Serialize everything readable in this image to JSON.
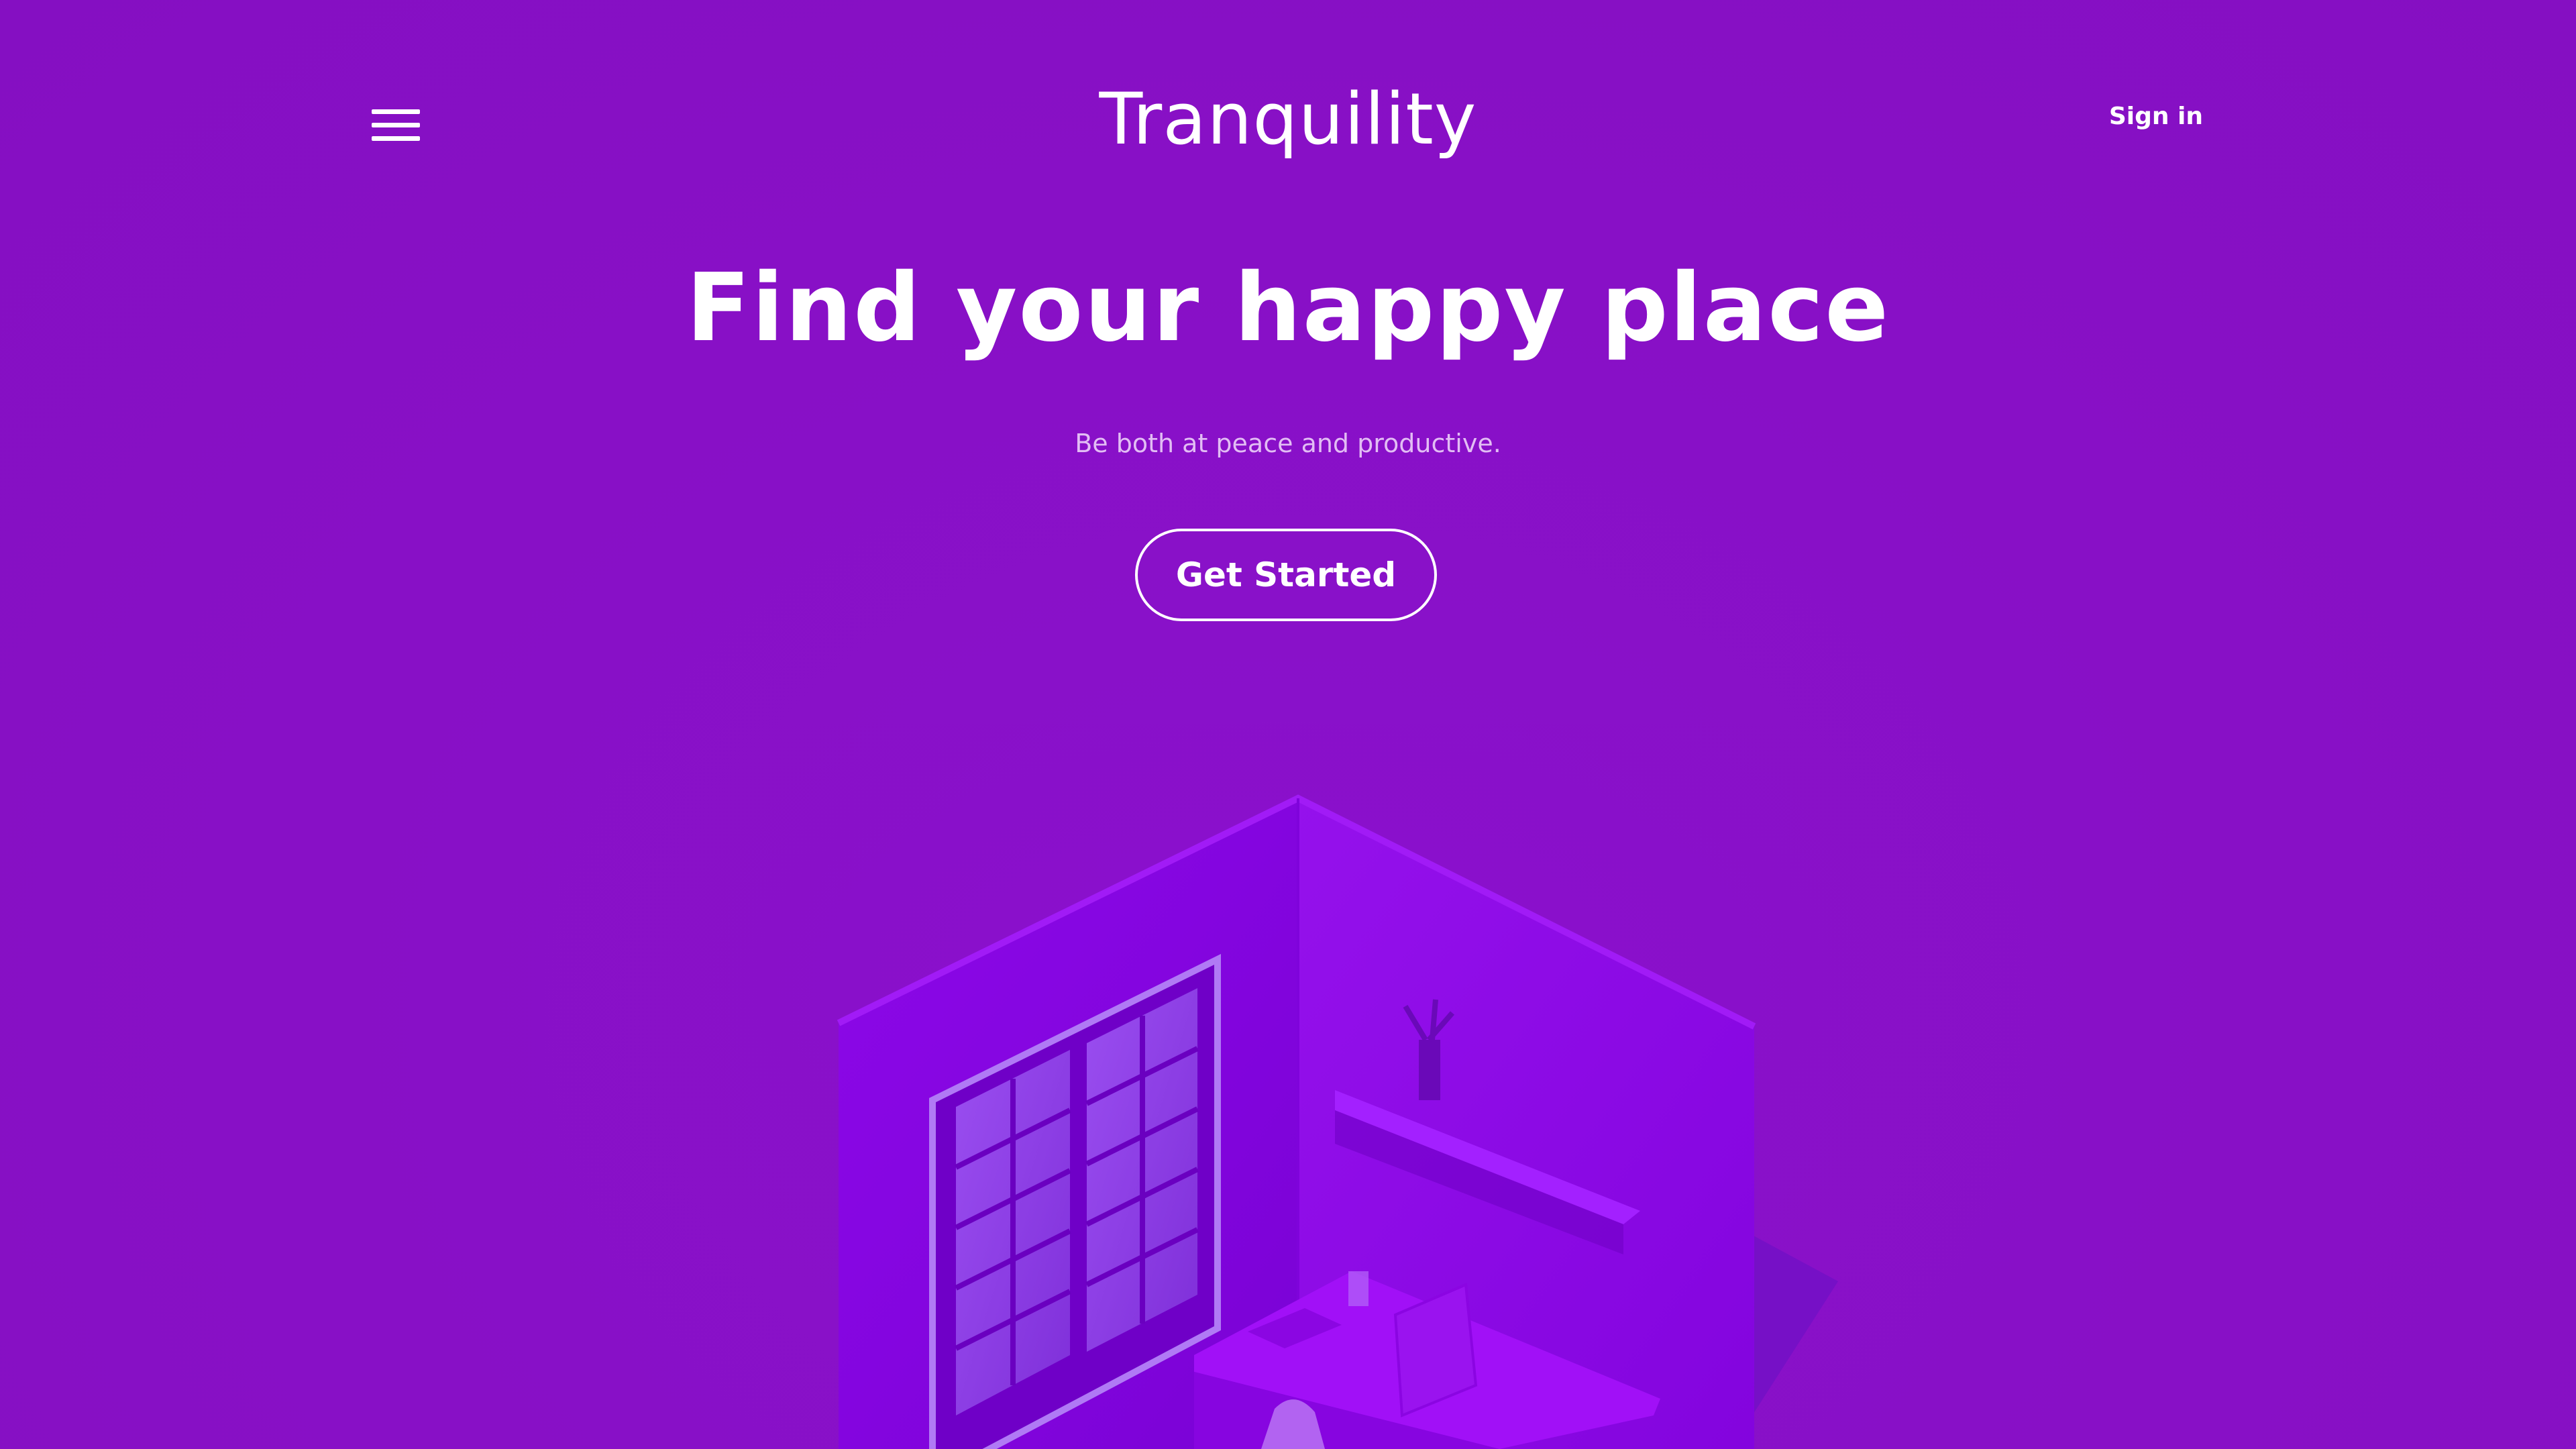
{
  "header": {
    "brand": "Tranquility",
    "signin_label": "Sign in",
    "menu_icon": "hamburger-menu-icon"
  },
  "hero": {
    "title": "Find your happy place",
    "subtitle": "Be both at peace and productive.",
    "cta_label": "Get Started"
  },
  "illustration": {
    "description_icon": "isometric-room-illustration"
  },
  "colors": {
    "background": "#8810c6",
    "text": "#ffffff",
    "subtitle": "#e2bdf4",
    "room_wall": "#8d08e8",
    "room_floor": "#7c04d6"
  }
}
